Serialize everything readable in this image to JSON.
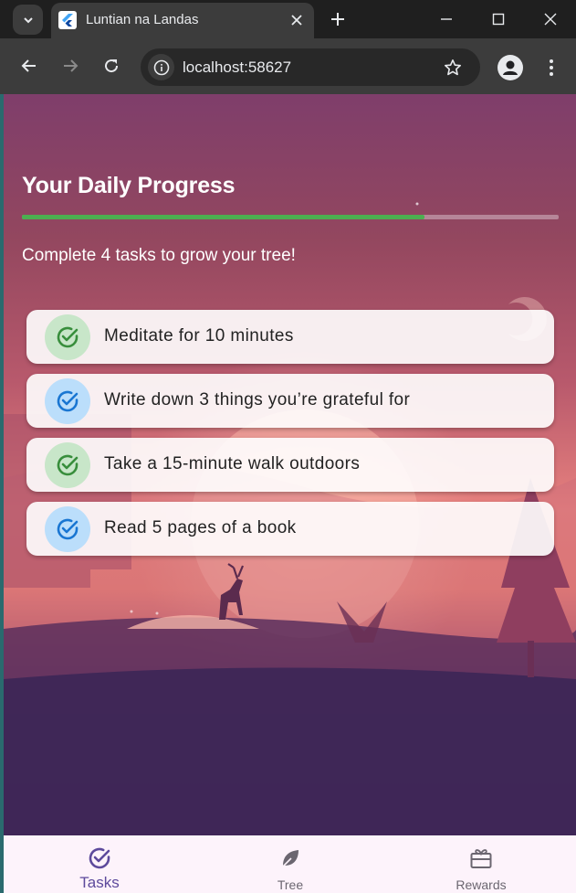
{
  "browser": {
    "tab_title": "Luntian na Landas",
    "url": "localhost:58627"
  },
  "page": {
    "progress_title": "Your Daily Progress",
    "progress_fraction": 0.75,
    "subtitle": "Complete 4 tasks to grow your tree!",
    "tasks": [
      {
        "label": "Meditate for 10 minutes",
        "icon": "check-circle-icon",
        "icon_bg": "#c8e6c9",
        "icon_color": "#388e3c"
      },
      {
        "label": "Write down 3 things you’re grateful for",
        "icon": "check-circle-icon",
        "icon_bg": "#bbdefb",
        "icon_color": "#1976d2"
      },
      {
        "label": "Take a 15-minute walk outdoors",
        "icon": "check-circle-icon",
        "icon_bg": "#c8e6c9",
        "icon_color": "#388e3c"
      },
      {
        "label": "Read 5 pages of a book",
        "icon": "check-circle-icon",
        "icon_bg": "#bbdefb",
        "icon_color": "#1976d2"
      }
    ]
  },
  "bottom_nav": {
    "items": [
      {
        "label": "Tasks",
        "icon": "check-circle-icon",
        "active": true
      },
      {
        "label": "Tree",
        "icon": "leaf-icon",
        "active": false
      },
      {
        "label": "Rewards",
        "icon": "gift-icon",
        "active": false
      }
    ]
  },
  "colors": {
    "progress_fill": "#4caf50",
    "nav_active": "#5d4a9c",
    "nav_inactive": "#6b6670"
  }
}
